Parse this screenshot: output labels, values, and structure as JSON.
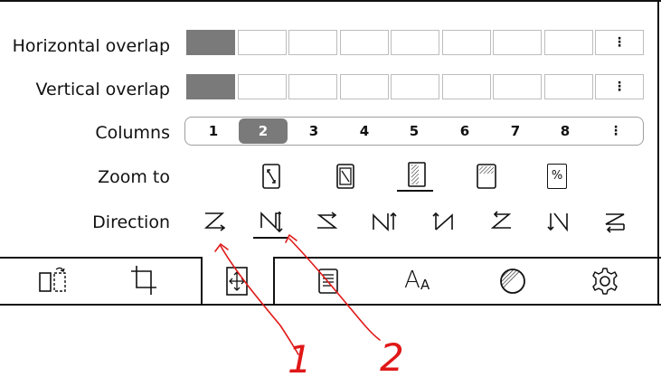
{
  "rows": {
    "horizontal_overlap": {
      "label": "Horizontal overlap",
      "value_steps": 1,
      "total_steps": 8,
      "more": "⋮"
    },
    "vertical_overlap": {
      "label": "Vertical overlap",
      "value_steps": 1,
      "total_steps": 8,
      "more": "⋮"
    },
    "columns": {
      "label": "Columns",
      "options": [
        "1",
        "2",
        "3",
        "4",
        "5",
        "6",
        "7",
        "8"
      ],
      "selected": "2",
      "more": "⋮"
    },
    "zoom_to": {
      "label": "Zoom to",
      "icons": [
        "fit-page-icon",
        "fit-content-icon",
        "fit-width-icon",
        "fit-height-icon",
        "zoom-percent-icon"
      ],
      "selected_index": 2,
      "percent_glyph": "%"
    },
    "direction": {
      "label": "Direction",
      "icons": [
        "z-right-down-icon",
        "n-down-right-icon",
        "z-right-up-icon",
        "n-up-right-icon",
        "n-up-left-icon",
        "z-left-down-icon",
        "n-down-left-icon",
        "z-left-up-icon"
      ],
      "selected_index": 1
    }
  },
  "bottom_tabs": [
    {
      "name": "rotate-tab",
      "icon": "rotate-page-icon"
    },
    {
      "name": "crop-tab",
      "icon": "crop-icon"
    },
    {
      "name": "layout-tab",
      "icon": "pan-arrows-icon",
      "active": true
    },
    {
      "name": "toc-tab",
      "icon": "document-icon"
    },
    {
      "name": "font-tab",
      "icon": "font-size-icon",
      "glyph_big": "A",
      "glyph_small": "A"
    },
    {
      "name": "contrast-tab",
      "icon": "contrast-icon"
    },
    {
      "name": "settings-tab",
      "icon": "gear-icon"
    }
  ],
  "annotations": {
    "mark_1": "1",
    "mark_2": "2",
    "color": "#e01818"
  },
  "colors": {
    "selected": "#7a7a7a",
    "border": "#bdbdbd",
    "ink": "#111111"
  }
}
